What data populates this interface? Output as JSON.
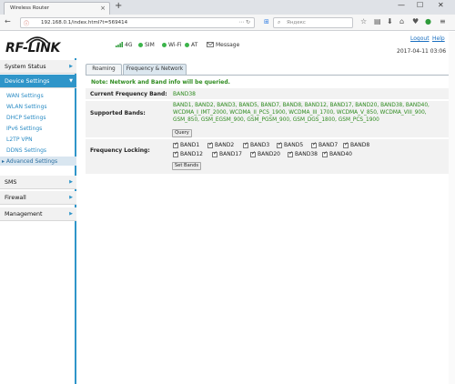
{
  "browser": {
    "tab_title": "Wireless Router",
    "url": "192.168.0.1/index.html?t=569414",
    "search_placeholder": "Яндекс"
  },
  "header": {
    "logo_text": "RF-LINK",
    "status": {
      "network": "4G",
      "sim": "SIM",
      "wifi": "Wi-Fi",
      "at": "AT",
      "message": "Message"
    },
    "logout": "Logout",
    "help": "Help",
    "datetime": "2017-04-11 03:06"
  },
  "colors": {
    "accent": "#2f95c9",
    "green": "#2e8b1f",
    "link": "#1a6fc0"
  },
  "sidebar": {
    "items": [
      {
        "label": "System Status"
      },
      {
        "label": "Device Settings"
      }
    ],
    "subitems": [
      {
        "label": "WAN Settings"
      },
      {
        "label": "WLAN Settings"
      },
      {
        "label": "DHCP Settings"
      },
      {
        "label": "IPv6 Settings"
      },
      {
        "label": "L2TP VPN"
      },
      {
        "label": "DDNS Settings"
      },
      {
        "label": "Advanced Settings"
      }
    ],
    "bottom_items": [
      {
        "label": "SMS"
      },
      {
        "label": "Firewall"
      },
      {
        "label": "Management"
      }
    ]
  },
  "main": {
    "tabs": [
      {
        "label": "Roaming"
      },
      {
        "label": "Frequency & Network"
      }
    ],
    "note": "Note: Network and Band info will be queried.",
    "current_band_label": "Current Frequency Band:",
    "current_band_value": "BAND38",
    "supported_label": "Supported Bands:",
    "supported_value": "BAND1, BAND2, BAND3, BAND5, BAND7, BAND8, BAND12, BAND17, BAND20, BAND38, BAND40, WCDMA_I_IMT_2000, WCDMA_II_PCS_1900, WCDMA_III_1700, WCDMA_V_850, WCDMA_VIII_900, GSM_850, GSM_EGSM_900, GSM_PGSM_900, GSM_DGS_1800, GSM_PCS_1900",
    "query_button": "Query",
    "locking_label": "Frequency Locking:",
    "bands": [
      "BAND1",
      "BAND2",
      "BAND3",
      "BAND5",
      "BAND7",
      "BAND8",
      "BAND12",
      "BAND17",
      "BAND20",
      "BAND38",
      "BAND40"
    ],
    "set_button": "Set Bands"
  }
}
